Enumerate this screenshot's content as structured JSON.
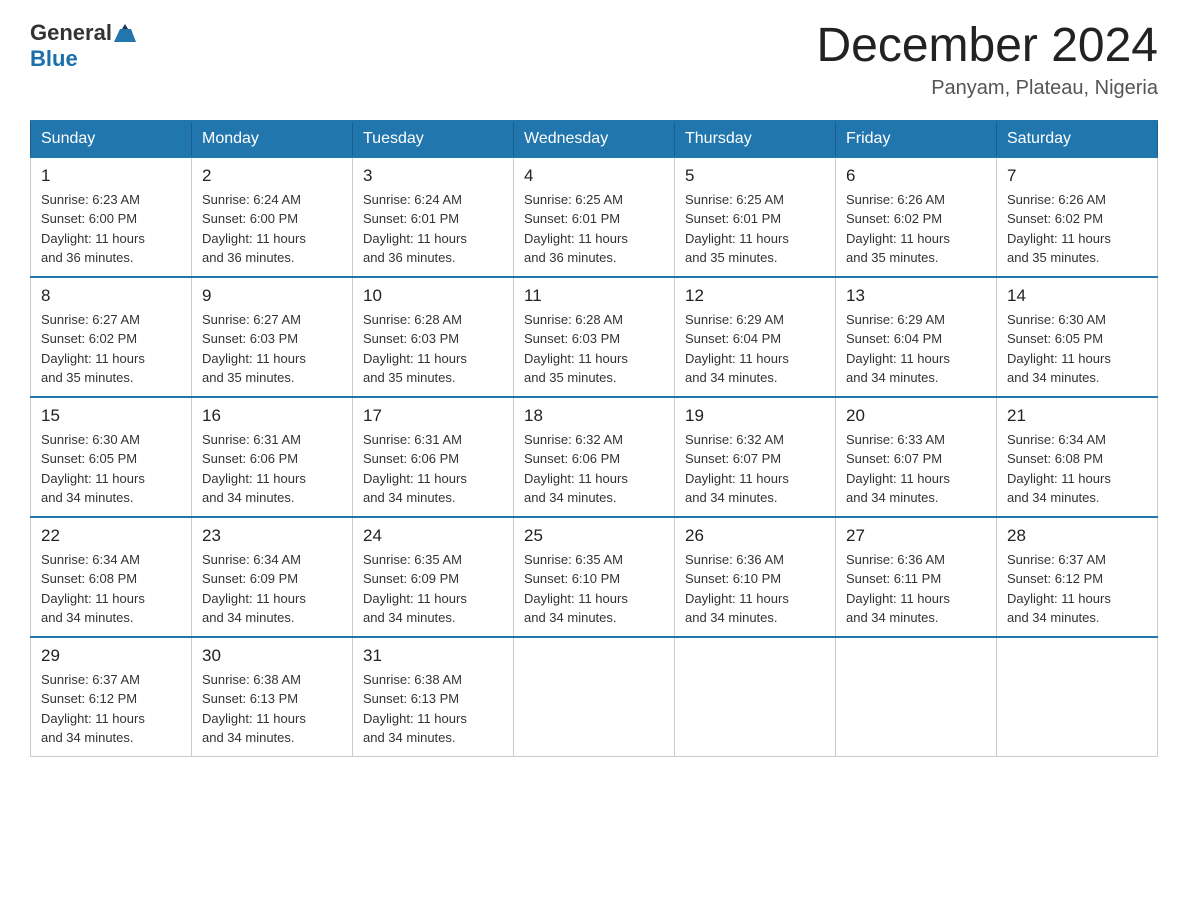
{
  "logo": {
    "general": "General",
    "blue": "Blue"
  },
  "title": "December 2024",
  "subtitle": "Panyam, Plateau, Nigeria",
  "days": [
    "Sunday",
    "Monday",
    "Tuesday",
    "Wednesday",
    "Thursday",
    "Friday",
    "Saturday"
  ],
  "weeks": [
    [
      {
        "date": "1",
        "sunrise": "6:23 AM",
        "sunset": "6:00 PM",
        "daylight": "11 hours and 36 minutes."
      },
      {
        "date": "2",
        "sunrise": "6:24 AM",
        "sunset": "6:00 PM",
        "daylight": "11 hours and 36 minutes."
      },
      {
        "date": "3",
        "sunrise": "6:24 AM",
        "sunset": "6:01 PM",
        "daylight": "11 hours and 36 minutes."
      },
      {
        "date": "4",
        "sunrise": "6:25 AM",
        "sunset": "6:01 PM",
        "daylight": "11 hours and 36 minutes."
      },
      {
        "date": "5",
        "sunrise": "6:25 AM",
        "sunset": "6:01 PM",
        "daylight": "11 hours and 35 minutes."
      },
      {
        "date": "6",
        "sunrise": "6:26 AM",
        "sunset": "6:02 PM",
        "daylight": "11 hours and 35 minutes."
      },
      {
        "date": "7",
        "sunrise": "6:26 AM",
        "sunset": "6:02 PM",
        "daylight": "11 hours and 35 minutes."
      }
    ],
    [
      {
        "date": "8",
        "sunrise": "6:27 AM",
        "sunset": "6:02 PM",
        "daylight": "11 hours and 35 minutes."
      },
      {
        "date": "9",
        "sunrise": "6:27 AM",
        "sunset": "6:03 PM",
        "daylight": "11 hours and 35 minutes."
      },
      {
        "date": "10",
        "sunrise": "6:28 AM",
        "sunset": "6:03 PM",
        "daylight": "11 hours and 35 minutes."
      },
      {
        "date": "11",
        "sunrise": "6:28 AM",
        "sunset": "6:03 PM",
        "daylight": "11 hours and 35 minutes."
      },
      {
        "date": "12",
        "sunrise": "6:29 AM",
        "sunset": "6:04 PM",
        "daylight": "11 hours and 34 minutes."
      },
      {
        "date": "13",
        "sunrise": "6:29 AM",
        "sunset": "6:04 PM",
        "daylight": "11 hours and 34 minutes."
      },
      {
        "date": "14",
        "sunrise": "6:30 AM",
        "sunset": "6:05 PM",
        "daylight": "11 hours and 34 minutes."
      }
    ],
    [
      {
        "date": "15",
        "sunrise": "6:30 AM",
        "sunset": "6:05 PM",
        "daylight": "11 hours and 34 minutes."
      },
      {
        "date": "16",
        "sunrise": "6:31 AM",
        "sunset": "6:06 PM",
        "daylight": "11 hours and 34 minutes."
      },
      {
        "date": "17",
        "sunrise": "6:31 AM",
        "sunset": "6:06 PM",
        "daylight": "11 hours and 34 minutes."
      },
      {
        "date": "18",
        "sunrise": "6:32 AM",
        "sunset": "6:06 PM",
        "daylight": "11 hours and 34 minutes."
      },
      {
        "date": "19",
        "sunrise": "6:32 AM",
        "sunset": "6:07 PM",
        "daylight": "11 hours and 34 minutes."
      },
      {
        "date": "20",
        "sunrise": "6:33 AM",
        "sunset": "6:07 PM",
        "daylight": "11 hours and 34 minutes."
      },
      {
        "date": "21",
        "sunrise": "6:34 AM",
        "sunset": "6:08 PM",
        "daylight": "11 hours and 34 minutes."
      }
    ],
    [
      {
        "date": "22",
        "sunrise": "6:34 AM",
        "sunset": "6:08 PM",
        "daylight": "11 hours and 34 minutes."
      },
      {
        "date": "23",
        "sunrise": "6:34 AM",
        "sunset": "6:09 PM",
        "daylight": "11 hours and 34 minutes."
      },
      {
        "date": "24",
        "sunrise": "6:35 AM",
        "sunset": "6:09 PM",
        "daylight": "11 hours and 34 minutes."
      },
      {
        "date": "25",
        "sunrise": "6:35 AM",
        "sunset": "6:10 PM",
        "daylight": "11 hours and 34 minutes."
      },
      {
        "date": "26",
        "sunrise": "6:36 AM",
        "sunset": "6:10 PM",
        "daylight": "11 hours and 34 minutes."
      },
      {
        "date": "27",
        "sunrise": "6:36 AM",
        "sunset": "6:11 PM",
        "daylight": "11 hours and 34 minutes."
      },
      {
        "date": "28",
        "sunrise": "6:37 AM",
        "sunset": "6:12 PM",
        "daylight": "11 hours and 34 minutes."
      }
    ],
    [
      {
        "date": "29",
        "sunrise": "6:37 AM",
        "sunset": "6:12 PM",
        "daylight": "11 hours and 34 minutes."
      },
      {
        "date": "30",
        "sunrise": "6:38 AM",
        "sunset": "6:13 PM",
        "daylight": "11 hours and 34 minutes."
      },
      {
        "date": "31",
        "sunrise": "6:38 AM",
        "sunset": "6:13 PM",
        "daylight": "11 hours and 34 minutes."
      },
      null,
      null,
      null,
      null
    ]
  ],
  "labels": {
    "sunrise": "Sunrise:",
    "sunset": "Sunset:",
    "daylight": "Daylight:"
  }
}
